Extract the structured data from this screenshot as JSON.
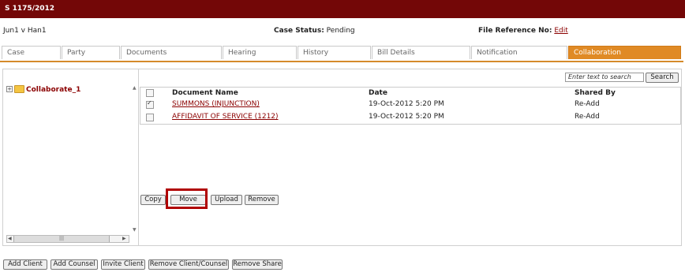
{
  "title": "S 1175/2012",
  "case_info": {
    "parties": "Jun1 v Han1",
    "status_label": "Case Status:",
    "status_value": "Pending",
    "file_ref_label": "File Reference No:",
    "file_ref_link": "Edit"
  },
  "tabs": [
    {
      "label": "Case",
      "active": false
    },
    {
      "label": "Party",
      "active": false
    },
    {
      "label": "Documents",
      "active": false
    },
    {
      "label": "Hearing",
      "active": false
    },
    {
      "label": "History",
      "active": false
    },
    {
      "label": "Bill Details",
      "active": false
    },
    {
      "label": "Notification",
      "active": false
    },
    {
      "label": "Collaboration",
      "active": true
    }
  ],
  "tree": {
    "expand": "+",
    "folder_label": "Collaborate_1"
  },
  "search": {
    "placeholder": "Enter text to search",
    "button": "Search"
  },
  "table": {
    "columns": [
      "Document Name",
      "Date",
      "Shared By"
    ],
    "rows": [
      {
        "name": "SUMMONS (INJUNCTION)",
        "date": "19-Oct-2012 5:20 PM",
        "shared_by": "Re-Add",
        "checked": true
      },
      {
        "name": "AFFIDAVIT OF SERVICE (1212)",
        "date": "19-Oct-2012 5:20 PM",
        "shared_by": "Re-Add",
        "checked": false
      }
    ]
  },
  "actions": {
    "copy": "Copy",
    "move": "Move",
    "upload": "Upload",
    "remove": "Remove"
  },
  "footer_buttons": {
    "add_client": "Add Client",
    "add_counsel": "Add Counsel",
    "invite_client": "Invite Client",
    "remove_client_counsel": "Remove Client/Counsel",
    "remove_share": "Remove Share"
  },
  "colors": {
    "title_bar": "#730707",
    "active_tab": "#e08a25",
    "link": "#8b0000",
    "highlight": "#b00000"
  }
}
